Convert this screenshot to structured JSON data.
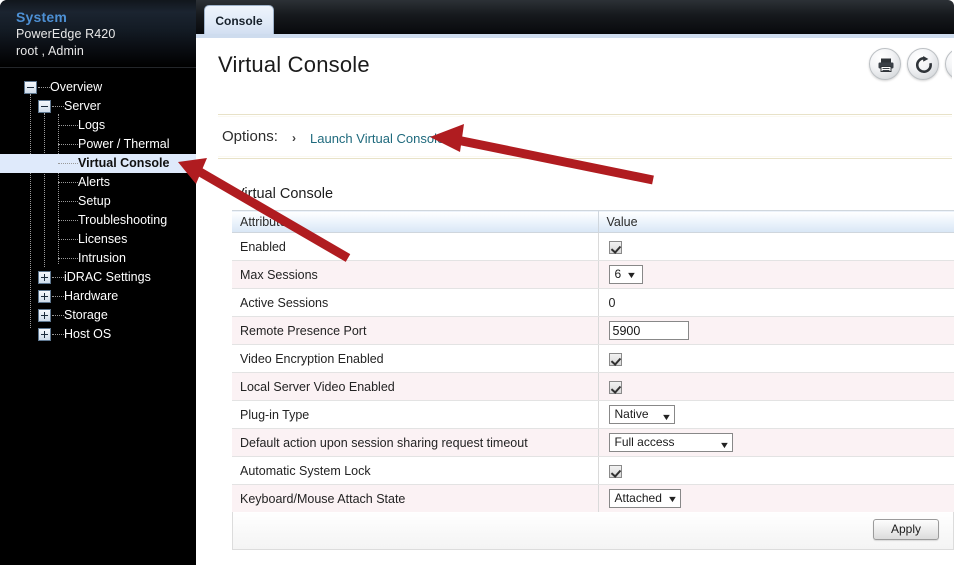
{
  "sidebar": {
    "header": {
      "title": "System",
      "model": "PowerEdge R420",
      "user": "root , Admin"
    },
    "tree": [
      {
        "label": "Overview",
        "depth": 0,
        "toggle": "minus",
        "selected": false
      },
      {
        "label": "Server",
        "depth": 1,
        "toggle": "minus",
        "selected": false
      },
      {
        "label": "Logs",
        "depth": 2,
        "toggle": "none",
        "selected": false
      },
      {
        "label": "Power / Thermal",
        "depth": 2,
        "toggle": "none",
        "selected": false
      },
      {
        "label": "Virtual Console",
        "depth": 2,
        "toggle": "none",
        "selected": true
      },
      {
        "label": "Alerts",
        "depth": 2,
        "toggle": "none",
        "selected": false
      },
      {
        "label": "Setup",
        "depth": 2,
        "toggle": "none",
        "selected": false
      },
      {
        "label": "Troubleshooting",
        "depth": 2,
        "toggle": "none",
        "selected": false
      },
      {
        "label": "Licenses",
        "depth": 2,
        "toggle": "none",
        "selected": false
      },
      {
        "label": "Intrusion",
        "depth": 2,
        "toggle": "none",
        "selected": false
      },
      {
        "label": "iDRAC Settings",
        "depth": 1,
        "toggle": "plus",
        "selected": false
      },
      {
        "label": "Hardware",
        "depth": 1,
        "toggle": "plus",
        "selected": false
      },
      {
        "label": "Storage",
        "depth": 1,
        "toggle": "plus",
        "selected": false
      },
      {
        "label": "Host OS",
        "depth": 1,
        "toggle": "plus",
        "selected": false
      }
    ]
  },
  "tabs": [
    {
      "label": "Console",
      "active": true
    }
  ],
  "page": {
    "title": "Virtual Console",
    "icons": [
      {
        "name": "print-icon",
        "glyph": "printer"
      },
      {
        "name": "refresh-icon",
        "glyph": "refresh"
      },
      {
        "name": "help-icon",
        "glyph": "help"
      }
    ]
  },
  "options": {
    "label": "Options:",
    "chevron": "›",
    "link": "Launch Virtual Console"
  },
  "section": {
    "title": "Virtual Console",
    "columns": [
      "Attribute",
      "Value"
    ],
    "rows": [
      {
        "attribute": "Enabled",
        "control": "checkbox",
        "value": "checked"
      },
      {
        "attribute": "Max Sessions",
        "control": "select",
        "value": "6",
        "width": "w-small"
      },
      {
        "attribute": "Active Sessions",
        "control": "text",
        "value": "0"
      },
      {
        "attribute": "Remote Presence Port",
        "control": "input",
        "value": "5900"
      },
      {
        "attribute": "Video Encryption Enabled",
        "control": "checkbox",
        "value": "checked"
      },
      {
        "attribute": "Local Server Video Enabled",
        "control": "checkbox",
        "value": "checked"
      },
      {
        "attribute": "Plug-in Type",
        "control": "select",
        "value": "Native",
        "width": "w-native"
      },
      {
        "attribute": "Default action upon session sharing request timeout",
        "control": "select",
        "value": "Full access",
        "width": "w-full"
      },
      {
        "attribute": "Automatic System Lock",
        "control": "checkbox",
        "value": "checked"
      },
      {
        "attribute": "Keyboard/Mouse Attach State",
        "control": "select",
        "value": "Attached",
        "width": "w-attach"
      }
    ]
  },
  "footer": {
    "apply_label": "Apply"
  },
  "colors": {
    "accent_blue": "#4d90d4",
    "selection_blue": "#dfeafb",
    "link_teal": "#1f6a7d",
    "row_alt_pink": "#fbf2f4",
    "annotation_red": "#b01c20",
    "sidebar_black": "#000000"
  },
  "annotations": [
    {
      "name": "arrow-to-launch-virtual-console",
      "points_to": "Launch Virtual Console"
    },
    {
      "name": "arrow-to-sidebar-virtual-console",
      "points_to": "Virtual Console"
    }
  ]
}
